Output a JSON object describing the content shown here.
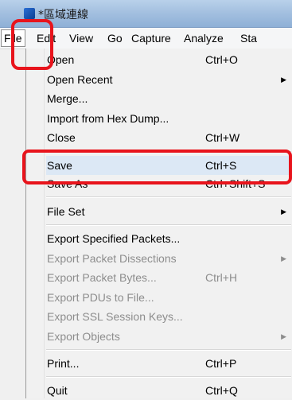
{
  "window": {
    "title": "*區域連線"
  },
  "menubar": {
    "items": [
      "File",
      "Edit",
      "View",
      "Go",
      "Capture",
      "Analyze",
      "Sta"
    ]
  },
  "file_menu": {
    "open": {
      "label": "Open",
      "shortcut": "Ctrl+O"
    },
    "open_recent": {
      "label": "Open Recent"
    },
    "merge": {
      "label": "Merge..."
    },
    "import_hex": {
      "label": "Import from Hex Dump..."
    },
    "close": {
      "label": "Close",
      "shortcut": "Ctrl+W"
    },
    "save": {
      "label": "Save",
      "shortcut": "Ctrl+S"
    },
    "save_as": {
      "label": "Save As",
      "shortcut": "Ctrl+Shift+S"
    },
    "file_set": {
      "label": "File Set"
    },
    "export_specified": {
      "label": "Export Specified Packets..."
    },
    "export_dissections": {
      "label": "Export Packet Dissections"
    },
    "export_bytes": {
      "label": "Export Packet Bytes...",
      "shortcut": "Ctrl+H"
    },
    "export_pdus": {
      "label": "Export PDUs to File..."
    },
    "export_ssl": {
      "label": "Export SSL Session Keys..."
    },
    "export_objects": {
      "label": "Export Objects"
    },
    "print": {
      "label": "Print...",
      "shortcut": "Ctrl+P"
    },
    "quit": {
      "label": "Quit",
      "shortcut": "Ctrl+Q"
    }
  },
  "colors": {
    "annotation": "#e8141c",
    "highlight": "#dce8f5",
    "disabled_text": "#8d8d8d"
  }
}
